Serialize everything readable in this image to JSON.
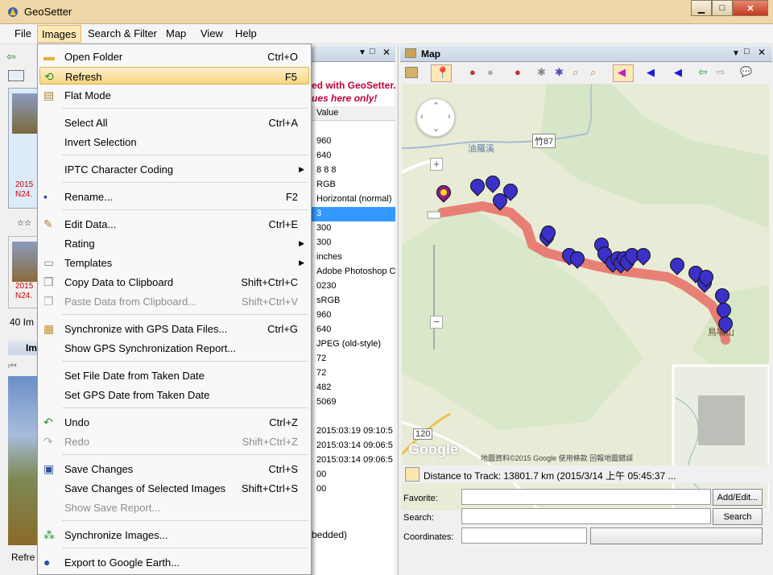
{
  "app": {
    "title": "GeoSetter"
  },
  "menubar": {
    "items": [
      "File",
      "Images",
      "Search & Filter",
      "Map",
      "View",
      "Help"
    ]
  },
  "left": {
    "thumb1_text": [
      "2015",
      "N24."
    ],
    "thumb2_text": [
      "2015",
      "N24."
    ],
    "count": "40 Im",
    "im_label": "Im",
    "status": "Refre"
  },
  "middle": {
    "banner1": "ed with GeoSetter.",
    "banner2": "ues here only!",
    "header": "Value",
    "values": [
      "960",
      "640",
      "8 8 8",
      "RGB",
      "Horizontal (normal)",
      "3",
      "300",
      "300",
      "inches",
      "Adobe Photoshop C",
      "0230",
      "sRGB",
      "960",
      "640",
      "JPEG (old-style)",
      "72",
      "72",
      "482",
      "5069",
      "",
      "2015:03:19 09:10:5",
      "2015:03:14 09:06:5",
      "2015:03:14 09:06:5",
      "00",
      "00"
    ],
    "footer": "bedded)"
  },
  "map": {
    "panel_title": "Map",
    "labels": {
      "creek": "油羅溪",
      "road1": "竹87",
      "road2": "120",
      "peak": "鳥嘴山"
    },
    "attribution": "地圖資料©2015 Google   使用條款   回報地圖錯誤",
    "google": "Google",
    "distance": "Distance to Track: 13801.7 km (2015/3/14 上午 05:45:37 ...",
    "favorite_label": "Favorite:",
    "search_label": "Search:",
    "coordinates_label": "Coordinates:",
    "add_edit_btn": "Add/Edit...",
    "search_btn": "Search",
    "colors": {
      "track": "#e8736a",
      "marker": "#3b30c8",
      "selected_marker": "#f5e000"
    }
  },
  "menu": {
    "items": [
      {
        "label": "Open Folder",
        "shortcut": "Ctrl+O",
        "icon": "folder-icon"
      },
      {
        "label": "Refresh",
        "shortcut": "F5",
        "icon": "refresh-icon"
      },
      {
        "label": "Flat Mode",
        "shortcut": "",
        "icon": "flat-mode-icon"
      },
      {
        "label": "Select All",
        "shortcut": "Ctrl+A",
        "icon": ""
      },
      {
        "label": "Invert Selection",
        "shortcut": "",
        "icon": ""
      },
      {
        "label": "IPTC Character Coding",
        "shortcut": "",
        "icon": ""
      },
      {
        "label": "Rename...",
        "shortcut": "F2",
        "icon": "rename-icon"
      },
      {
        "label": "Edit Data...",
        "shortcut": "Ctrl+E",
        "icon": "edit-data-icon"
      },
      {
        "label": "Rating",
        "shortcut": "",
        "icon": ""
      },
      {
        "label": "Templates",
        "shortcut": "",
        "icon": "templates-icon"
      },
      {
        "label": "Copy Data to Clipboard",
        "shortcut": "Shift+Ctrl+C",
        "icon": "copy-icon"
      },
      {
        "label": "Paste Data from Clipboard...",
        "shortcut": "Shift+Ctrl+V",
        "icon": "paste-icon"
      },
      {
        "label": "Synchronize with GPS Data Files...",
        "shortcut": "Ctrl+G",
        "icon": "gps-sync-icon"
      },
      {
        "label": "Show GPS Synchronization Report...",
        "shortcut": "",
        "icon": ""
      },
      {
        "label": "Set File Date from Taken Date",
        "shortcut": "",
        "icon": ""
      },
      {
        "label": "Set GPS Date from Taken Date",
        "shortcut": "",
        "icon": ""
      },
      {
        "label": "Undo",
        "shortcut": "Ctrl+Z",
        "icon": "undo-icon"
      },
      {
        "label": "Redo",
        "shortcut": "Shift+Ctrl+Z",
        "icon": "redo-icon"
      },
      {
        "label": "Save Changes",
        "shortcut": "Ctrl+S",
        "icon": "save-icon"
      },
      {
        "label": "Save Changes of Selected Images",
        "shortcut": "Shift+Ctrl+S",
        "icon": ""
      },
      {
        "label": "Show Save Report...",
        "shortcut": "",
        "icon": ""
      },
      {
        "label": "Synchronize Images...",
        "shortcut": "",
        "icon": "sync-images-icon"
      },
      {
        "label": "Export to Google Earth...",
        "shortcut": "",
        "icon": "google-earth-icon"
      }
    ]
  }
}
